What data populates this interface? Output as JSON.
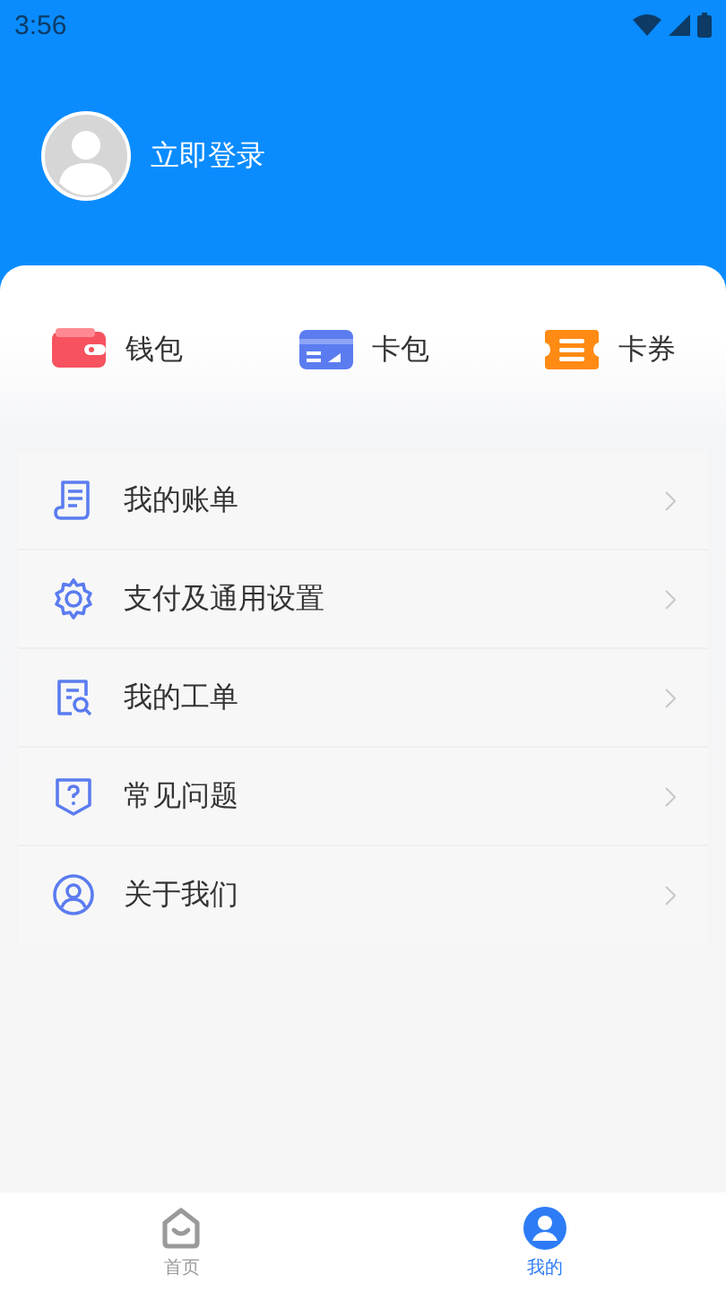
{
  "status_bar": {
    "time": "3:56"
  },
  "profile": {
    "login_label": "立即登录"
  },
  "shortcuts": [
    {
      "kind": "wallet",
      "label": "钱包"
    },
    {
      "kind": "card",
      "label": "卡包"
    },
    {
      "kind": "coupon",
      "label": "卡券"
    }
  ],
  "menu": [
    {
      "kind": "bill",
      "label": "我的账单"
    },
    {
      "kind": "settings",
      "label": "支付及通用设置"
    },
    {
      "kind": "ticket",
      "label": "我的工单"
    },
    {
      "kind": "faq",
      "label": "常见问题"
    },
    {
      "kind": "about",
      "label": "关于我们"
    }
  ],
  "tab_bar": [
    {
      "kind": "home",
      "label": "首页",
      "selected": false
    },
    {
      "kind": "me",
      "label": "我的",
      "selected": true
    }
  ]
}
